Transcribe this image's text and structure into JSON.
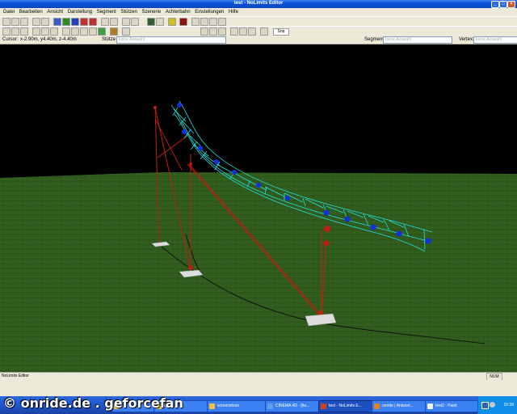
{
  "window": {
    "title": "test - NoLimits Editor"
  },
  "menu": [
    "Datei",
    "Bearbeiten",
    "Ansicht",
    "Darstellung",
    "Segment",
    "Stützen",
    "Szenerie",
    "Achterbahn",
    "Einstellungen",
    "Hilfe"
  ],
  "infobar": {
    "cursor_label": "Cursor:",
    "cursor_value": "x-2.90m, y4.40m, z-4.40m",
    "stuetze_label": "Stütze",
    "stuetze_value": "keine Auswahl",
    "segment_label": "Segment:",
    "segment_value": "keine Auswahl",
    "vertex_label": "Vertex:",
    "vertex_value": "keine Auswahl"
  },
  "toolbar": {
    "snap_label": "Snp"
  },
  "statusbar": {
    "left": "NoLimits Editor",
    "num": "NUM"
  },
  "taskbar": {
    "items": [
      "",
      "test",
      "screenshots",
      "CINEMA 4D - [Ite...",
      "test - NoLimits E...",
      "onride | Antwort...",
      "test2 - Paint"
    ],
    "clock": "15:38"
  },
  "watermark": "© onride.de . geforcefan",
  "scene_colors": {
    "sky": "#000000",
    "grass": "#2f5a1c",
    "track": "#20e0e0",
    "support": "#c02010",
    "node": "#1030e0"
  }
}
